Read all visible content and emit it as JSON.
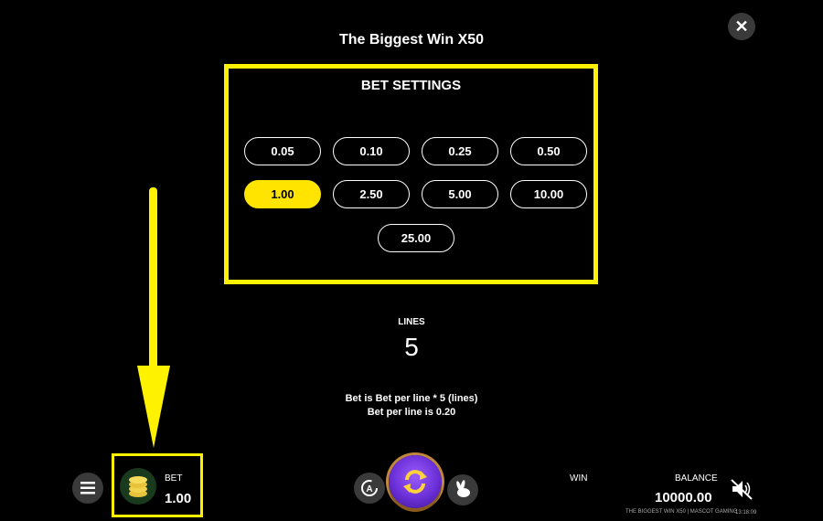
{
  "header": {
    "title": "The Biggest Win X50",
    "close_symbol": "✕"
  },
  "bet_settings": {
    "title": "BET SETTINGS",
    "options": [
      {
        "label": "0.05",
        "selected": false
      },
      {
        "label": "0.10",
        "selected": false
      },
      {
        "label": "0.25",
        "selected": false
      },
      {
        "label": "0.50",
        "selected": false
      },
      {
        "label": "1.00",
        "selected": true
      },
      {
        "label": "2.50",
        "selected": false
      },
      {
        "label": "5.00",
        "selected": false
      },
      {
        "label": "10.00",
        "selected": false
      },
      {
        "label": "25.00",
        "selected": false
      }
    ]
  },
  "lines": {
    "label": "LINES",
    "value": "5"
  },
  "info": {
    "line1": "Bet is Bet per line * 5 (lines)",
    "line2": "Bet per line is 0.20"
  },
  "bottom_bar": {
    "bet_label": "BET",
    "bet_value": "1.00",
    "win_label": "WIN",
    "balance_label": "BALANCE",
    "balance_value": "10000.00",
    "footer_text": "THE BIGGEST WIN X50 | MASCOT GAMING",
    "time": "13:18:09"
  },
  "colors": {
    "highlight": "#fff200",
    "selected_chip": "#ffe400",
    "spin": "#7b3ff0"
  }
}
